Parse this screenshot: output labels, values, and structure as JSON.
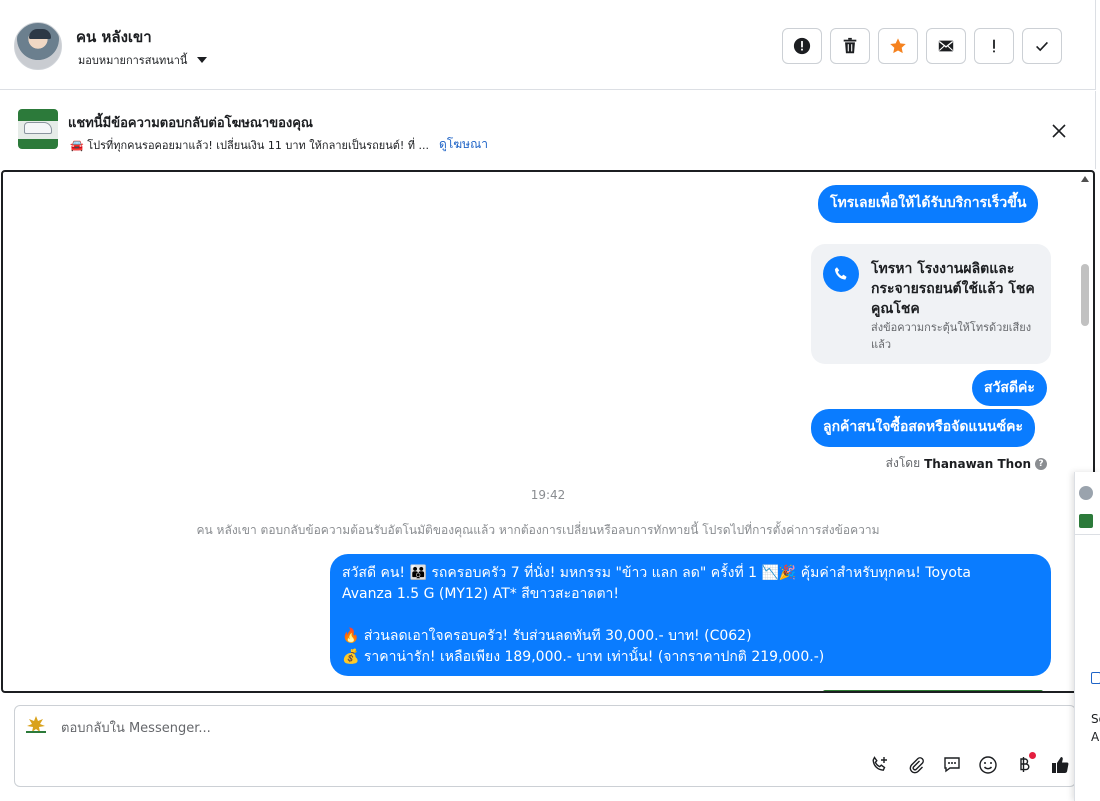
{
  "header": {
    "contact_name": "คน หลังเขา",
    "assign_label": "มอบหมายการสนทนานี้"
  },
  "toolbar": {
    "tools": [
      "report-icon",
      "trash-icon",
      "star-icon",
      "mail-icon",
      "exclamation-icon",
      "check-icon"
    ],
    "star_color": "#f5821f"
  },
  "ad_banner": {
    "title": "แชทนี้มีข้อความตอบกลับต่อโฆษณาของคุณ",
    "subtitle": "🚘 โปรที่ทุกคนรอคอยมาแล้ว! เปลี่ยนเงิน 11 บาท ให้กลายเป็นรถยนต์! ที่ ...",
    "view_link": "ดูโฆษณา"
  },
  "messages": {
    "m1": "โทรเลยเพื่อให้ได้รับบริการเร็วขึ้น",
    "call_card": {
      "title": "โทรหา โรงงานผลิตและกระจายรถยนต์ใช้แล้ว โชคคูณโชค",
      "subtitle": "ส่งข้อความกระตุ้นให้โทรด้วยเสียงแล้ว"
    },
    "m3": "สวัสดีค่ะ",
    "m4": "ลูกค้าสนใจซื้อสดหรือจัดแนนซ์คะ",
    "sent_by_prefix": "ส่งโดย",
    "sent_by_name": "Thanawan Thon",
    "time": "19:42",
    "system_note": "คน หลังเขา ตอบกลับข้อความต้อนรับอัตโนมัติของคุณแล้ว หากต้องการเปลี่ยนหรือลบการทักทายนี้ โปรดไปที่การตั้งค่าการส่งข้อความ",
    "big": {
      "line1": "สวัสดี คน! 👪 รถครอบครัว 7 ที่นั่ง! มหกรรม \"ข้าว แลก ลด\" ครั้งที่ 1 📉🎉 คุ้มค่าสำหรับทุกคน! Toyota",
      "line2": "Avanza 1.5 G (MY12) AT* สีขาวสะอาดตา!",
      "line3": "🔥 ส่วนลดเอาใจครอบครัว! รับส่วนลดทันที 30,000.- บาท! (C062)",
      "line4": "💰 ราคาน่ารัก! เหลือเพียง 189,000.- บาท เท่านั้น! (จากราคาปกติ 219,000.-)"
    }
  },
  "composer": {
    "placeholder": "ตอบกลับใน Messenger...",
    "actions": [
      "add-call-icon",
      "attach-icon",
      "saved-reply-icon",
      "emoji-icon",
      "baht-icon",
      "like-icon"
    ]
  },
  "side_panel": {
    "text_line1": "So",
    "text_line2": "A"
  },
  "colors": {
    "bubble": "#0a7cff",
    "link": "#1f64c7"
  }
}
